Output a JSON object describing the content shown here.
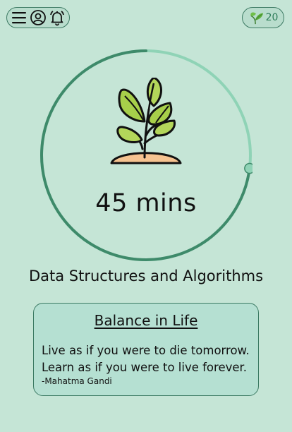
{
  "header": {
    "menu_icon": "menu-icon",
    "profile_icon": "user-circle-icon",
    "bell_icon": "bell-icon",
    "coins": {
      "icon": "sprout-icon",
      "count": "20"
    }
  },
  "timer": {
    "display": "45 mins",
    "progress": 0.27,
    "ring_color": "#3e8a6a",
    "remaining_color": "#8fd3b6",
    "illustration": "plant-sprout-illustration"
  },
  "task": {
    "title": "Data Structures and Algorithms"
  },
  "quote": {
    "title": "Balance in Life",
    "line1": "Live as if you were to die tomorrow.",
    "line2": "Learn as if you were to live forever.",
    "author": "-Mahatma Gandi"
  }
}
